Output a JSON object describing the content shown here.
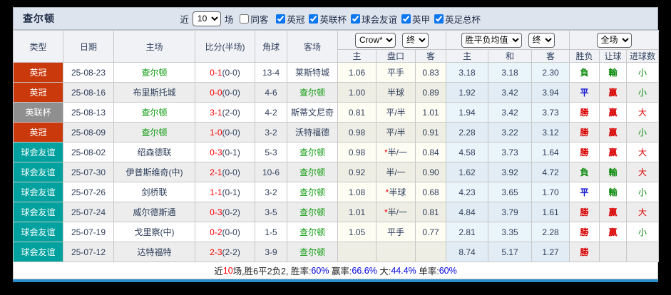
{
  "colors": {
    "toolbar_bg": "#dee4ed",
    "header_bg": "#f1f2f6",
    "text": "#30405c",
    "league_red": "#c9390b",
    "league_gray": "#8f8f8f",
    "league_teal": "#00a19e",
    "team_green": "#0c9a0c",
    "score_red": "#ff0000",
    "result_red": "#d90000",
    "result_green": "#0a8a0a",
    "result_blue": "#1414d2",
    "summary_blue": "#0000e0",
    "bluebar": "#2a8ecb"
  },
  "toolbar": {
    "title": "查尔顿",
    "near_label": "近",
    "matches_selected": "10",
    "matches_label": "场",
    "same_away_label": "同客",
    "same_away_checked": false,
    "leagues": [
      {
        "label": "英冠",
        "checked": true
      },
      {
        "label": "英联杯",
        "checked": true
      },
      {
        "label": "球会友谊",
        "checked": true
      },
      {
        "label": "英甲",
        "checked": true
      },
      {
        "label": "英足总杯",
        "checked": true
      }
    ]
  },
  "header": {
    "left_columns": [
      "类型",
      "日期",
      "主场",
      "比分(半场)",
      "角球",
      "客场"
    ],
    "selects": {
      "bookmaker": "Crow*",
      "bookmaker_state": "终",
      "avg": "胜平负均值",
      "avg_state": "终",
      "scope": "全场"
    },
    "odds_columns": [
      "主",
      "盘口",
      "客"
    ],
    "avg_columns": [
      "主",
      "和",
      "客"
    ],
    "result_columns": [
      "胜负",
      "让球",
      "进球数"
    ]
  },
  "rows": [
    {
      "type": {
        "text": "英冠",
        "cls": "lg-red"
      },
      "date": "25-08-23",
      "home": {
        "text": "查尔顿",
        "green": true
      },
      "score": "0-1",
      "half": "(0-0)",
      "corner": "13-4",
      "away": {
        "text": "莱斯特城",
        "green": false
      },
      "odds_home": "1.06",
      "handicap": {
        "star": false,
        "text": "平手"
      },
      "odds_away": "0.83",
      "avg_home": "3.18",
      "avg_draw": "3.18",
      "avg_away": "2.30",
      "outcome": {
        "text": "負",
        "cls": "g"
      },
      "handicap_result": {
        "text": "輸",
        "cls": "g"
      },
      "goals": {
        "text": "小",
        "cls": "g"
      }
    },
    {
      "type": {
        "text": "英冠",
        "cls": "lg-red"
      },
      "date": "25-08-16",
      "home": {
        "text": "布里斯托城",
        "green": false
      },
      "score": "0-0",
      "half": "(0-0)",
      "corner": "4-6",
      "away": {
        "text": "查尔顿",
        "green": true
      },
      "odds_home": "1.00",
      "handicap": {
        "star": false,
        "text": "半球"
      },
      "odds_away": "0.89",
      "avg_home": "1.92",
      "avg_draw": "3.42",
      "avg_away": "3.94",
      "outcome": {
        "text": "平",
        "cls": "b"
      },
      "handicap_result": {
        "text": "贏",
        "cls": "r"
      },
      "goals": {
        "text": "小",
        "cls": "g"
      }
    },
    {
      "type": {
        "text": "英联杯",
        "cls": "lg-gray"
      },
      "date": "25-08-13",
      "home": {
        "text": "查尔顿",
        "green": true
      },
      "score": "3-1",
      "half": "(2-0)",
      "corner": "4-2",
      "away": {
        "text": "斯蒂文尼奇",
        "green": false
      },
      "odds_home": "0.81",
      "handicap": {
        "star": false,
        "text": "平/半"
      },
      "odds_away": "1.01",
      "avg_home": "1.94",
      "avg_draw": "3.42",
      "avg_away": "3.73",
      "outcome": {
        "text": "勝",
        "cls": "r"
      },
      "handicap_result": {
        "text": "贏",
        "cls": "r"
      },
      "goals": {
        "text": "大",
        "cls": "r"
      }
    },
    {
      "type": {
        "text": "英冠",
        "cls": "lg-red"
      },
      "date": "25-08-09",
      "home": {
        "text": "查尔顿",
        "green": true
      },
      "score": "1-0",
      "half": "(0-0)",
      "corner": "3-2",
      "away": {
        "text": "沃特福德",
        "green": false
      },
      "odds_home": "0.98",
      "handicap": {
        "star": false,
        "text": "平/半"
      },
      "odds_away": "0.91",
      "avg_home": "2.28",
      "avg_draw": "3.22",
      "avg_away": "3.12",
      "outcome": {
        "text": "勝",
        "cls": "r"
      },
      "handicap_result": {
        "text": "贏",
        "cls": "r"
      },
      "goals": {
        "text": "小",
        "cls": "g"
      }
    },
    {
      "type": {
        "text": "球会友谊",
        "cls": "lg-teal"
      },
      "date": "25-08-02",
      "home": {
        "text": "绍森德联",
        "green": false
      },
      "score": "0-3",
      "half": "(0-1)",
      "corner": "5-3",
      "away": {
        "text": "查尔顿",
        "green": true
      },
      "odds_home": "0.98",
      "handicap": {
        "star": true,
        "text": "半/一"
      },
      "odds_away": "0.84",
      "avg_home": "4.58",
      "avg_draw": "3.73",
      "avg_away": "1.64",
      "outcome": {
        "text": "勝",
        "cls": "r"
      },
      "handicap_result": {
        "text": "贏",
        "cls": "r"
      },
      "goals": {
        "text": "大",
        "cls": "r"
      }
    },
    {
      "type": {
        "text": "球会友谊",
        "cls": "lg-teal"
      },
      "date": "25-07-30",
      "home": {
        "text": "伊普斯维奇(中)",
        "green": false
      },
      "score": "2-1",
      "half": "(0-0)",
      "corner": "10-6",
      "away": {
        "text": "查尔顿",
        "green": true
      },
      "odds_home": "0.92",
      "handicap": {
        "star": false,
        "text": "半/一"
      },
      "odds_away": "0.90",
      "avg_home": "1.62",
      "avg_draw": "3.92",
      "avg_away": "4.72",
      "outcome": {
        "text": "負",
        "cls": "g"
      },
      "handicap_result": {
        "text": "輸",
        "cls": "g"
      },
      "goals": {
        "text": "大",
        "cls": "r"
      }
    },
    {
      "type": {
        "text": "球会友谊",
        "cls": "lg-teal"
      },
      "date": "25-07-26",
      "home": {
        "text": "剑桥联",
        "green": false
      },
      "score": "1-1",
      "half": "(0-1)",
      "corner": "3-2",
      "away": {
        "text": "查尔顿",
        "green": true
      },
      "odds_home": "1.08",
      "handicap": {
        "star": true,
        "text": "半球"
      },
      "odds_away": "0.68",
      "avg_home": "4.23",
      "avg_draw": "3.65",
      "avg_away": "1.70",
      "outcome": {
        "text": "平",
        "cls": "b"
      },
      "handicap_result": {
        "text": "輸",
        "cls": "g"
      },
      "goals": {
        "text": "小",
        "cls": "g"
      }
    },
    {
      "type": {
        "text": "球会友谊",
        "cls": "lg-teal"
      },
      "date": "25-07-24",
      "home": {
        "text": "威尔德斯通",
        "green": false
      },
      "score": "0-3",
      "half": "(0-2)",
      "corner": "3-5",
      "away": {
        "text": "查尔顿",
        "green": true
      },
      "odds_home": "1.01",
      "handicap": {
        "star": true,
        "text": "半/一"
      },
      "odds_away": "0.81",
      "avg_home": "4.84",
      "avg_draw": "3.79",
      "avg_away": "1.61",
      "outcome": {
        "text": "勝",
        "cls": "r"
      },
      "handicap_result": {
        "text": "贏",
        "cls": "r"
      },
      "goals": {
        "text": "大",
        "cls": "r"
      }
    },
    {
      "type": {
        "text": "球会友谊",
        "cls": "lg-teal"
      },
      "date": "25-07-19",
      "home": {
        "text": "戈里察(中)",
        "green": false
      },
      "score": "0-2",
      "half": "(0-0)",
      "corner": "1-5",
      "away": {
        "text": "查尔顿",
        "green": true
      },
      "odds_home": "1.05",
      "handicap": {
        "star": false,
        "text": "平手"
      },
      "odds_away": "0.77",
      "avg_home": "2.81",
      "avg_draw": "3.35",
      "avg_away": "2.28",
      "outcome": {
        "text": "勝",
        "cls": "r"
      },
      "handicap_result": {
        "text": "贏",
        "cls": "r"
      },
      "goals": {
        "text": "小",
        "cls": "g"
      }
    },
    {
      "type": {
        "text": "球会友谊",
        "cls": "lg-teal"
      },
      "date": "25-07-12",
      "home": {
        "text": "达特福特",
        "green": false
      },
      "score": "2-3",
      "half": "(2-2)",
      "corner": "3-9",
      "away": {
        "text": "查尔顿",
        "green": true
      },
      "odds_home": "",
      "handicap": {
        "star": false,
        "text": ""
      },
      "odds_away": "",
      "avg_home": "8.74",
      "avg_draw": "5.17",
      "avg_away": "1.27",
      "outcome": {
        "text": "勝",
        "cls": "r"
      },
      "handicap_result": {
        "text": "",
        "cls": ""
      },
      "goals": {
        "text": "",
        "cls": ""
      }
    }
  ],
  "summary": {
    "segments": [
      {
        "text": "近",
        "cls": "d"
      },
      {
        "text": "10",
        "cls": "s-red"
      },
      {
        "text": "场,胜6平2负2, 胜率:",
        "cls": "d"
      },
      {
        "text": "60%",
        "cls": "s-blue"
      },
      {
        "text": " 赢率:",
        "cls": "d"
      },
      {
        "text": "66.6%",
        "cls": "s-blue"
      },
      {
        "text": " 大:",
        "cls": "d"
      },
      {
        "text": "44.4%",
        "cls": "s-blue"
      },
      {
        "text": " 单率:",
        "cls": "d"
      },
      {
        "text": "60%",
        "cls": "s-blue"
      }
    ]
  }
}
